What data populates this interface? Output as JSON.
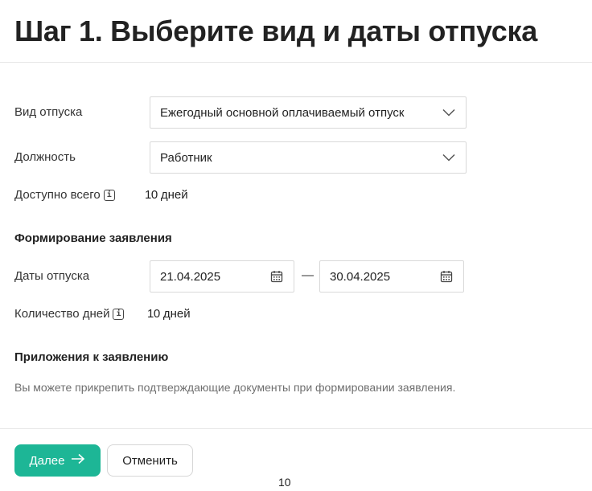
{
  "header": {
    "title": "Шаг 1. Выберите вид и даты отпуска"
  },
  "form": {
    "leave_type": {
      "label": "Вид отпуска",
      "value": "Ежегодный основной оплачиваемый отпуск",
      "icon": "chevron-down-icon"
    },
    "position": {
      "label": "Должность",
      "value": "Работник",
      "icon": "chevron-down-icon"
    },
    "available": {
      "label": "Доступно всего",
      "number": "10",
      "unit": "дней",
      "icon": "info-icon"
    }
  },
  "application": {
    "section_title": "Формирование заявления",
    "dates": {
      "label": "Даты отпуска",
      "from": "21.04.2025",
      "separator": "—",
      "to": "30.04.2025",
      "icon": "calendar-icon"
    },
    "days_count": {
      "label": "Количество дней",
      "number": "10",
      "unit": "дней",
      "icon": "info-icon"
    }
  },
  "attachments": {
    "section_title": "Приложения к заявлению",
    "hint": "Вы можете прикрепить подтверждающие документы при формировании заявления."
  },
  "footer": {
    "next_label": "Далее",
    "cancel_label": "Отменить",
    "page_number": "10"
  },
  "colors": {
    "accent": "#1db696",
    "divider": "#e6e6e6",
    "hint_text": "#6f6f6f"
  }
}
